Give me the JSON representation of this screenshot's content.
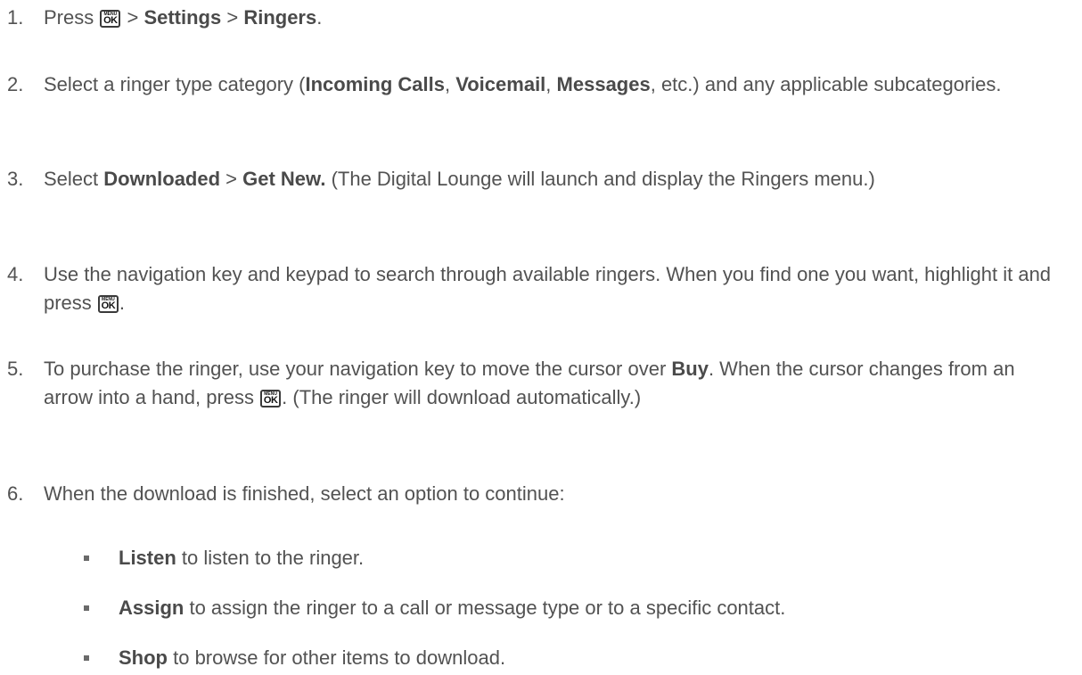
{
  "key": {
    "menu": "MENU",
    "ok": "OK"
  },
  "steps": [
    {
      "num": "1.",
      "t1": "Press ",
      "t2": " > ",
      "b1": "Settings",
      "t3": " > ",
      "b2": "Ringers",
      "t4": "."
    },
    {
      "num": "2.",
      "t1": "Select a ringer type category (",
      "b1": "Incoming Calls",
      "t2": ", ",
      "b2": "Voicemail",
      "t3": ", ",
      "b3": "Messages",
      "t4": ", etc.) and any applicable subcategories."
    },
    {
      "num": "3.",
      "t1": "Select ",
      "b1": "Downloaded",
      "t2": " > ",
      "b2": "Get New.",
      "t3": " (The Digital Lounge will launch and display the Ringers menu.)"
    },
    {
      "num": "4.",
      "t1": "Use the navigation key and keypad to search through available ringers. When you find one you want, highlight it and press ",
      "t2": "."
    },
    {
      "num": "5.",
      "t1": "To purchase the ringer, use your navigation key to move the cursor over ",
      "b1": "Buy",
      "t2": ". When the cursor changes from an arrow into a hand, press ",
      "t3": ". (The ringer will download automatically.)"
    },
    {
      "num": "6.",
      "t1": "When the download is finished, select an option to continue:"
    }
  ],
  "options": [
    {
      "b": "Listen",
      "t": " to listen to the ringer."
    },
    {
      "b": "Assign",
      "t": " to assign the ringer to a call or message type or to a specific contact."
    },
    {
      "b": "Shop",
      "t": " to browse for other items to download."
    }
  ]
}
